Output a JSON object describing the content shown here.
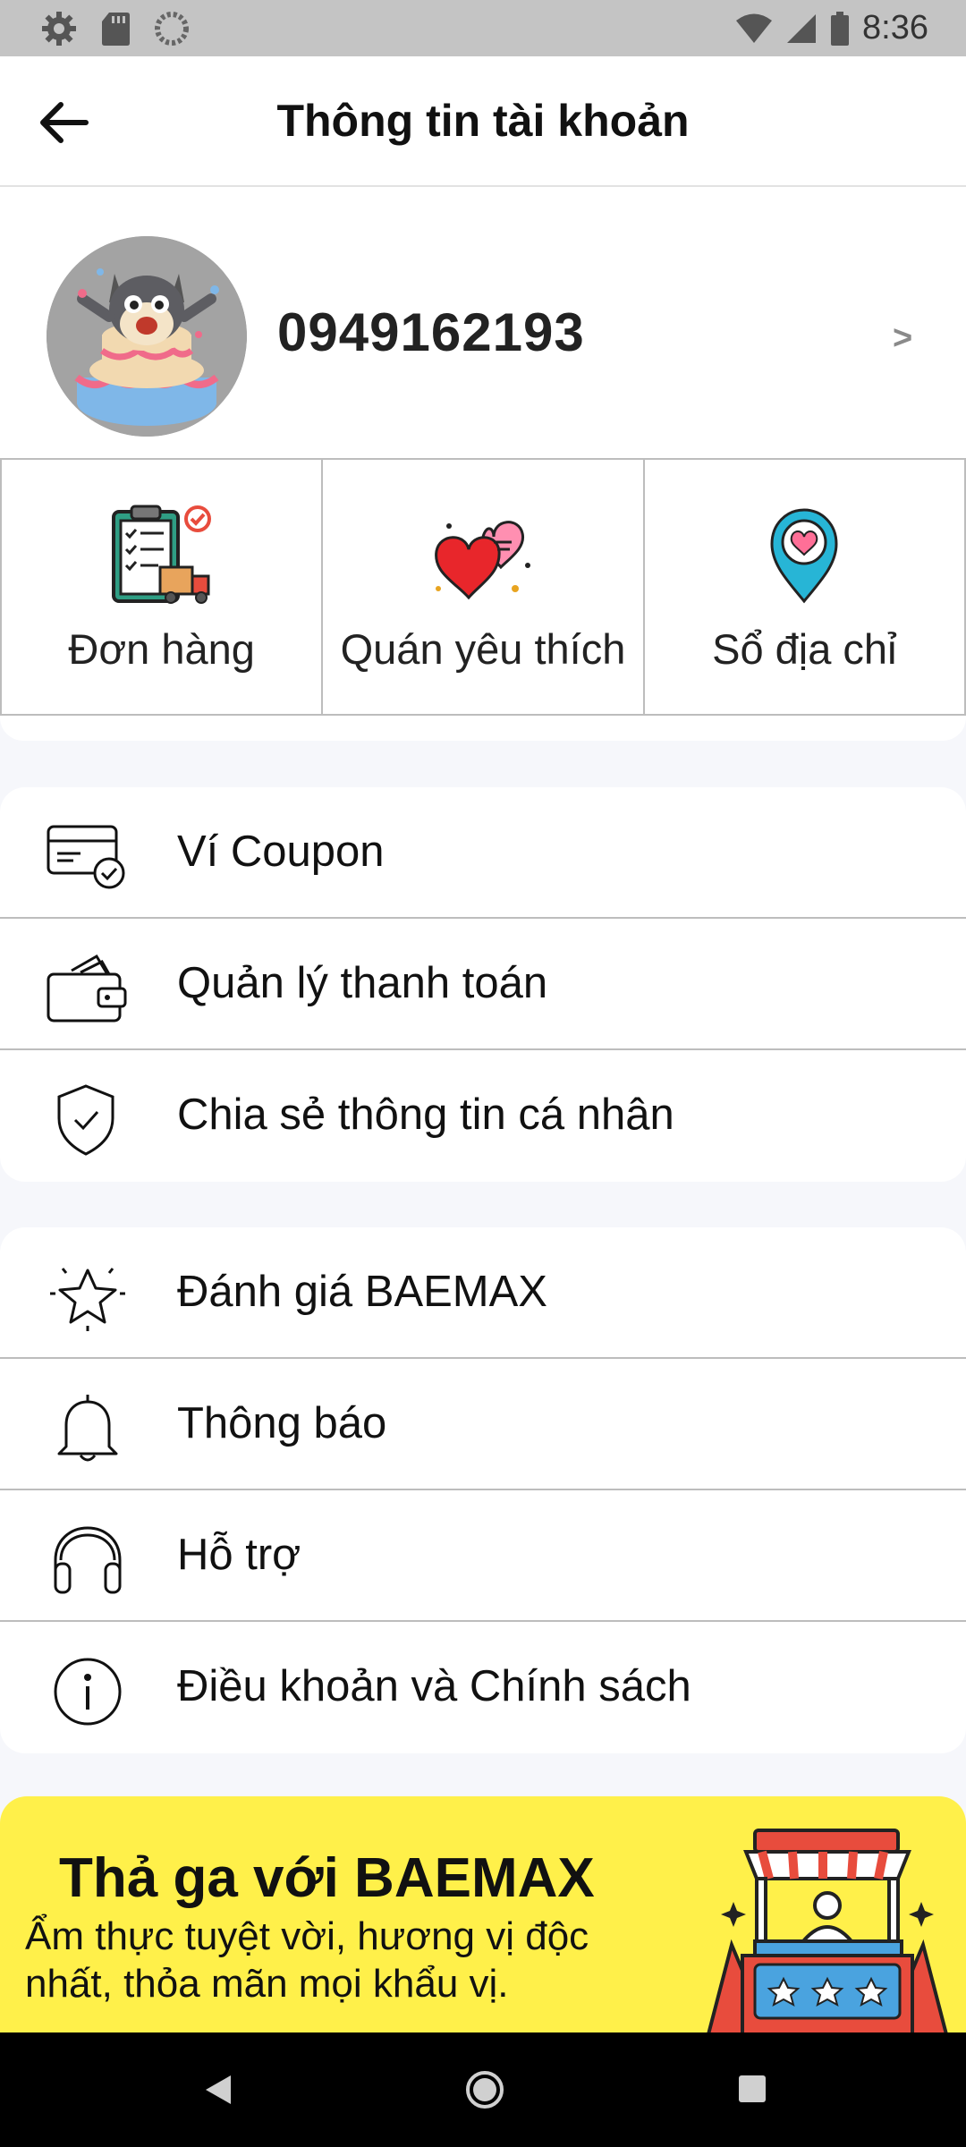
{
  "status_bar": {
    "time": "8:36",
    "left_icons": [
      "settings-icon",
      "sd-card-icon",
      "sync-icon"
    ],
    "right_icons": [
      "wifi-icon",
      "signal-icon",
      "battery-icon"
    ]
  },
  "header": {
    "title": "Thông tin tài khoản",
    "back_icon": "arrow-left-icon"
  },
  "profile": {
    "phone": "0949162193",
    "chevron": ">"
  },
  "quick_actions": [
    {
      "label": "Đơn hàng",
      "icon": "order-clipboard-icon"
    },
    {
      "label": "Quán yêu thích",
      "icon": "hearts-icon"
    },
    {
      "label": "Sổ địa chỉ",
      "icon": "location-pin-icon"
    }
  ],
  "menu_group_1": [
    {
      "label": "Ví Coupon",
      "icon": "coupon-card-icon"
    },
    {
      "label": "Quản lý thanh toán",
      "icon": "wallet-icon"
    },
    {
      "label": "Chia sẻ thông tin cá nhân",
      "icon": "shield-check-icon"
    }
  ],
  "menu_group_2": [
    {
      "label": "Đánh giá BAEMAX",
      "icon": "star-icon"
    },
    {
      "label": "Thông báo",
      "icon": "bell-icon"
    },
    {
      "label": "Hỗ trợ",
      "icon": "headphones-icon"
    },
    {
      "label": "Điều khoản và Chính sách",
      "icon": "info-icon"
    }
  ],
  "banner": {
    "title": "Thả ga với BAEMAX",
    "text": "Ẩm thực tuyệt vời, hương vị độc nhất, thỏa mãn mọi khẩu vị.",
    "colors": {
      "background": "#fff04a"
    }
  },
  "nav_bar": [
    "back-icon",
    "home-icon",
    "recents-icon"
  ]
}
